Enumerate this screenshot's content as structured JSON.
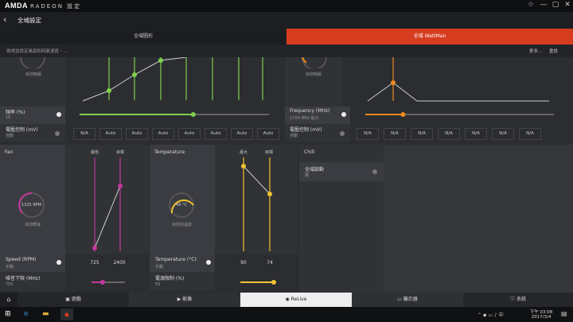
{
  "app": {
    "logo": "AMDA",
    "name": "RADEON 設定",
    "window_controls": [
      "☆",
      "—",
      "▢",
      "✕"
    ]
  },
  "nav": {
    "back_icon": "arrow-left",
    "title": "全域設定"
  },
  "tabs": [
    {
      "label": "全域圖形",
      "active": false
    },
    {
      "label": "全域 WattMan",
      "active": true
    }
  ],
  "info": {
    "text": "檢視並設定風扇和時脈速度・...",
    "more": "更多...",
    "reset": "重設"
  },
  "gpu_left": {
    "gauge_caption": "目前時脈",
    "freq_label": "頻率 (%)",
    "freq_value": "10",
    "volt_label": "電壓控制 (mV)",
    "volt_value": "自動",
    "slider_level": 0.6,
    "states": [
      "N/A",
      "Auto",
      "Auto",
      "Auto",
      "Auto",
      "Auto",
      "Auto",
      "Auto"
    ]
  },
  "memory": {
    "gauge_caption": "目前時脈",
    "freq_label": "Frequency (MHz)",
    "freq_value": "1750 MHz 最大",
    "volt_label": "電壓控制 (mV)",
    "volt_value": "自動",
    "slider_level": 0.2,
    "states": [
      "N/A",
      "N/A",
      "N/A",
      "N/A",
      "N/A",
      "N/A",
      "N/A"
    ]
  },
  "fan": {
    "title": "Fan",
    "gauge_value": "1325 RPM",
    "gauge_caption": "目前轉速",
    "col_min": "最低",
    "col_target": "目標",
    "speed_label": "Speed (RPM)",
    "speed_value": "手動",
    "min_acoustic_label": "噪音下限 (MHz)",
    "min_acoustic_value": "700",
    "min_value": "725",
    "target_value": "2400",
    "accent": "#c2389a"
  },
  "temperature": {
    "title": "Temperature",
    "gauge_value": "49 °C",
    "gauge_caption": "目前的溫度",
    "col_max": "最大",
    "col_target": "目標",
    "temp_label": "Temperature (°C)",
    "temp_value": "手動",
    "power_label": "電源限制 (%)",
    "power_value": "50",
    "max_value": "90",
    "target_value": "74",
    "accent": "#f2c230"
  },
  "chill": {
    "title": "Chill",
    "global_label": "全域啟動",
    "global_value": "關"
  },
  "bottom_tabs": [
    {
      "icon": "home-icon",
      "label": ""
    },
    {
      "icon": "gamepad-icon",
      "label": "遊戲"
    },
    {
      "icon": "video-icon",
      "label": "影像"
    },
    {
      "icon": "relive-icon",
      "label": "ReLive"
    },
    {
      "icon": "display-icon",
      "label": "顯示器"
    },
    {
      "icon": "info-icon",
      "label": "系統"
    }
  ],
  "taskbar": {
    "time": "下午 03:08",
    "date": "2017/3/4"
  },
  "colors": {
    "green": "#7ed04a",
    "orange": "#f08a1f",
    "accent_tab": "#d63d1f"
  }
}
